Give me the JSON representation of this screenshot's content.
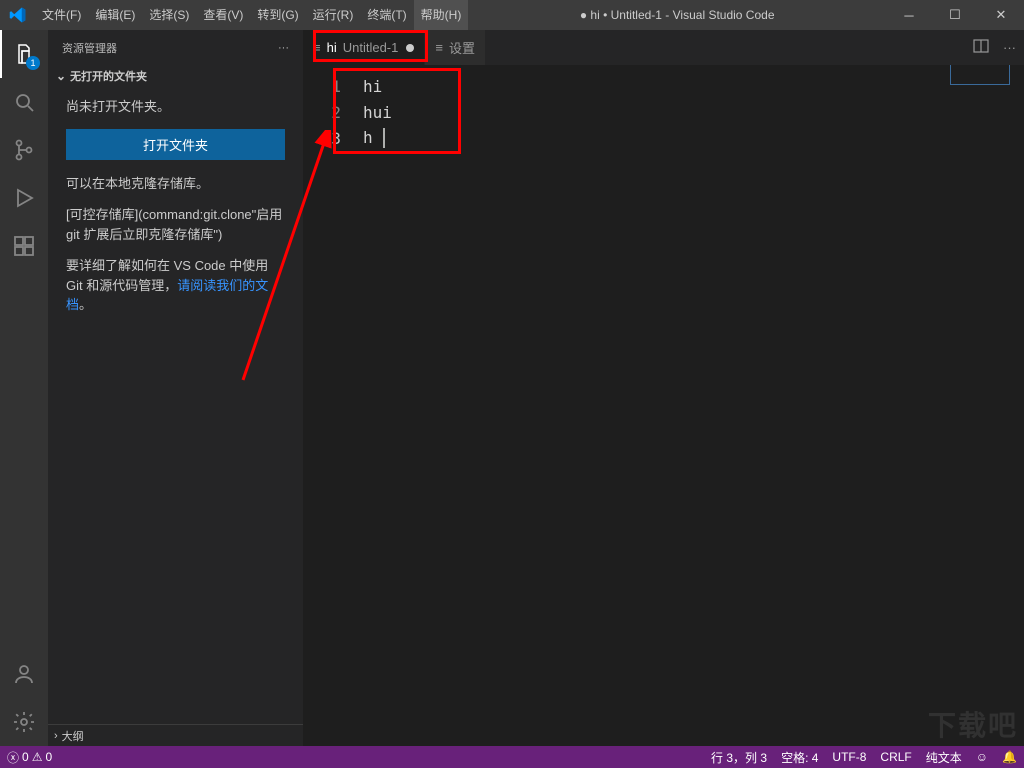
{
  "title": "● hi • Untitled-1 - Visual Studio Code",
  "menu": [
    "文件(F)",
    "编辑(E)",
    "选择(S)",
    "查看(V)",
    "转到(G)",
    "运行(R)",
    "终端(T)",
    "帮助(H)"
  ],
  "menu_active_index": 7,
  "activitybar": {
    "explorer_badge": "1"
  },
  "sidebar": {
    "title": "资源管理器",
    "section": "无打开的文件夹",
    "msg_no_folder": "尚未打开文件夹。",
    "open_folder_btn": "打开文件夹",
    "msg_clone": "可以在本地克隆存储库。",
    "msg_repo": "[可控存储库](command:git.clone\"启用 git 扩展后立即克隆存储库\")",
    "msg_learn_prefix": "要详细了解如何在 VS Code 中使用 Git 和源代码管理，",
    "msg_learn_link": "请阅读我们的文档",
    "msg_learn_suffix": "。",
    "outline": "大纲"
  },
  "tabs": [
    {
      "icon": "≡",
      "label_a": "hi",
      "label_b": "Untitled-1",
      "dirty": true,
      "active": true
    },
    {
      "icon": "≡",
      "label_a": "设置",
      "label_b": "",
      "dirty": false,
      "active": false
    }
  ],
  "editor": {
    "lines": [
      {
        "n": "1",
        "text": "hi"
      },
      {
        "n": "2",
        "text": "hui"
      },
      {
        "n": "3",
        "text": "h "
      }
    ],
    "current_line": 3
  },
  "statusbar": {
    "errors": "0",
    "warnings": "0",
    "line_col": "行 3，列 3",
    "spaces": "空格: 4",
    "encoding": "UTF-8",
    "eol": "CRLF",
    "lang": "纯文本",
    "feedback_icon": "☺",
    "bell_icon": "🔔"
  },
  "watermark": "下载吧"
}
